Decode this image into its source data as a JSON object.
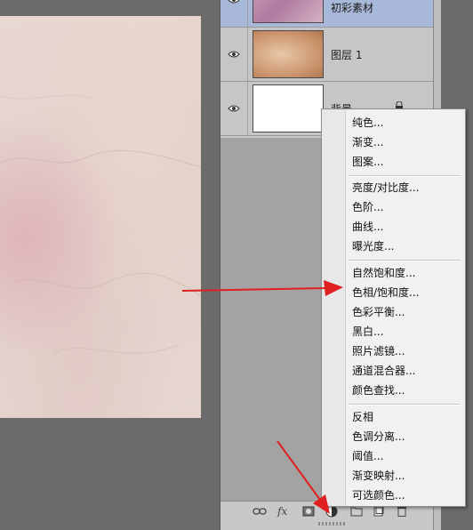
{
  "layers": [
    {
      "name": "初彩素材",
      "selected": true,
      "locked": false
    },
    {
      "name": "图层 1",
      "selected": false,
      "locked": false
    },
    {
      "name": "背景",
      "selected": false,
      "locked": true
    }
  ],
  "adjustment_menu": {
    "groups": [
      [
        "纯色...",
        "渐变...",
        "图案..."
      ],
      [
        "亮度/对比度...",
        "色阶...",
        "曲线...",
        "曝光度..."
      ],
      [
        "自然饱和度...",
        "色相/饱和度...",
        "色彩平衡...",
        "黑白...",
        "照片滤镜...",
        "通道混合器...",
        "颜色查找..."
      ],
      [
        "反相",
        "色调分离...",
        "阈值...",
        "渐变映射...",
        "可选颜色..."
      ]
    ]
  },
  "bottom_bar": {
    "link_icon": "link-icon",
    "fx_label": "fx",
    "mask_icon": "mask-icon",
    "adjustment_icon": "adjustment-layer-icon",
    "group_icon": "folder-icon",
    "new_layer_icon": "new-layer-icon",
    "delete_icon": "trash-icon"
  },
  "colors": {
    "selection": "#a8b8d8",
    "arrow": "#e02020"
  }
}
